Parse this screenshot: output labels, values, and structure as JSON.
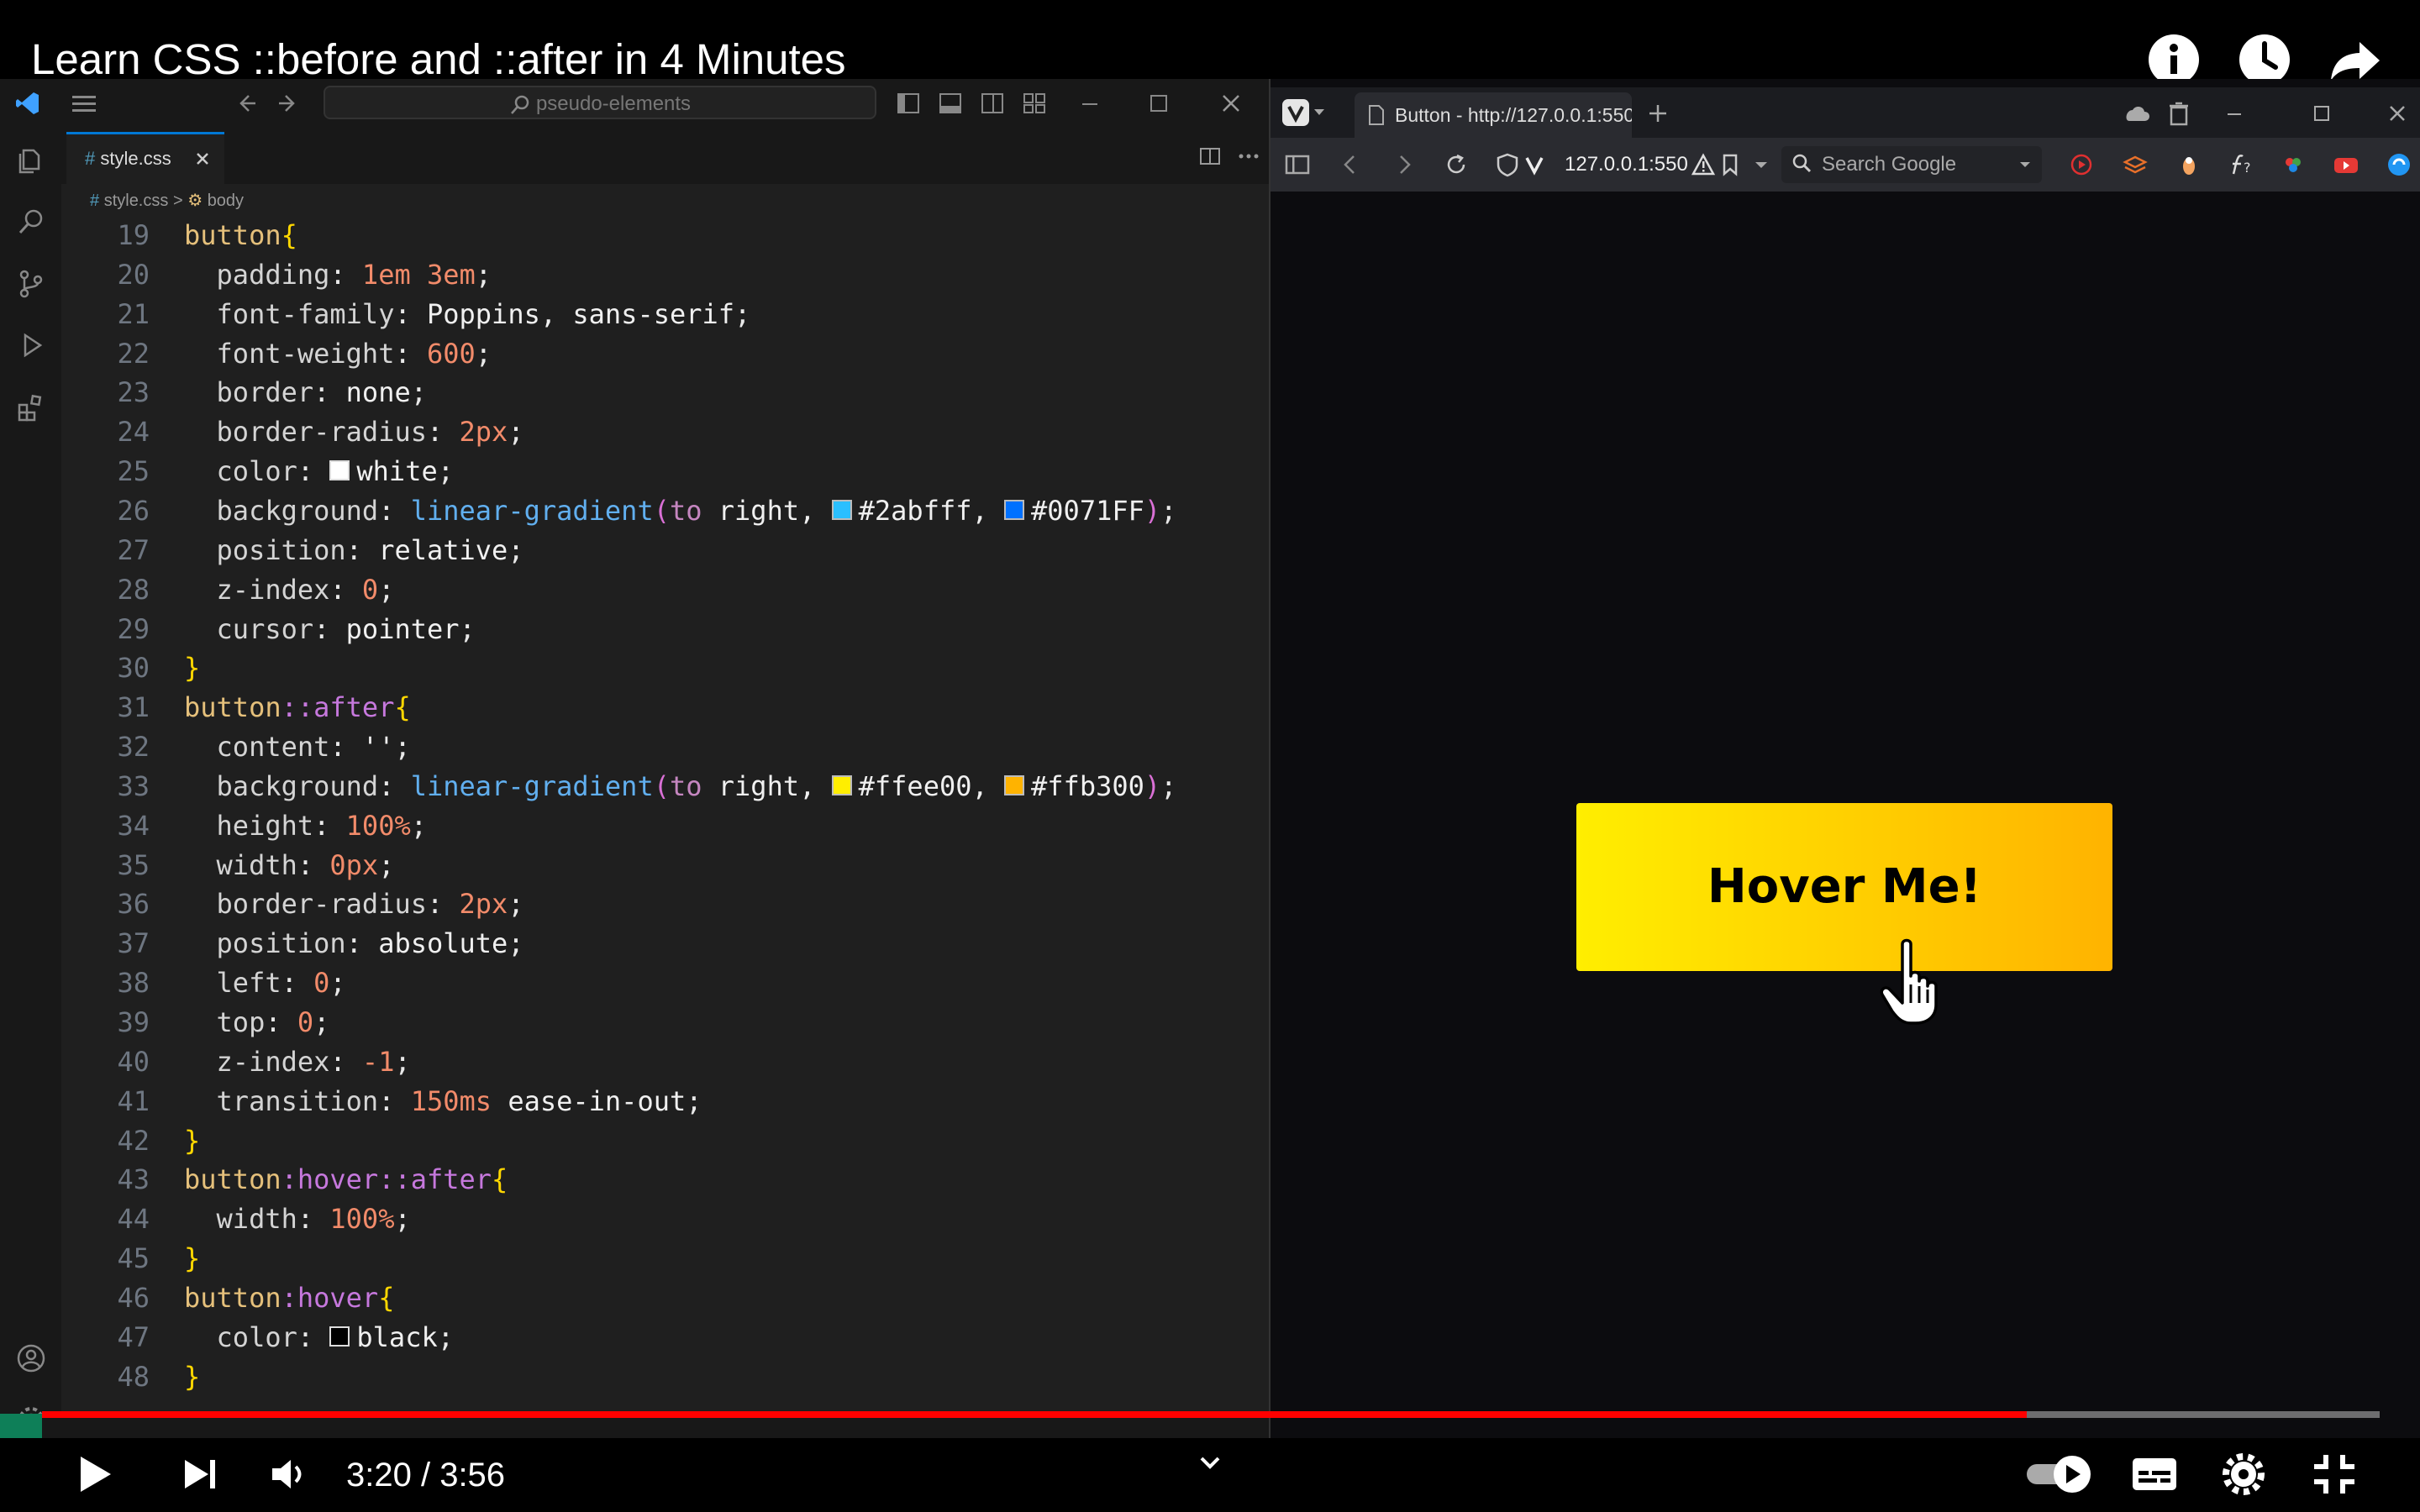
{
  "video": {
    "title": "Learn CSS ::before and ::after in 4 Minutes",
    "time": "3:20 / 3:56",
    "progress": 0.849
  },
  "vscode": {
    "search_text": "pseudo-elements",
    "tab_label": "style.css",
    "breadcrumb_file": "style.css",
    "breadcrumb_sep": ">",
    "breadcrumb_symbol": "body",
    "lines": [
      {
        "n": "19",
        "code": "button{"
      },
      {
        "n": "20",
        "code": "  padding: 1em 3em;"
      },
      {
        "n": "21",
        "code": "  font-family: Poppins, sans-serif;"
      },
      {
        "n": "22",
        "code": "  font-weight: 600;"
      },
      {
        "n": "23",
        "code": "  border: none;"
      },
      {
        "n": "24",
        "code": "  border-radius: 2px;"
      },
      {
        "n": "25",
        "code": "  color: white;"
      },
      {
        "n": "26",
        "code": "  background: linear-gradient(to right, #2abfff, #0071FF);"
      },
      {
        "n": "27",
        "code": "  position: relative;"
      },
      {
        "n": "28",
        "code": "  z-index: 0;"
      },
      {
        "n": "29",
        "code": "  cursor: pointer;"
      },
      {
        "n": "30",
        "code": "}"
      },
      {
        "n": "31",
        "code": "button::after{"
      },
      {
        "n": "32",
        "code": "  content: '';"
      },
      {
        "n": "33",
        "code": "  background: linear-gradient(to right, #ffee00, #ffb300);"
      },
      {
        "n": "34",
        "code": "  height: 100%;"
      },
      {
        "n": "35",
        "code": "  width: 0px;"
      },
      {
        "n": "36",
        "code": "  border-radius: 2px;"
      },
      {
        "n": "37",
        "code": "  position: absolute;"
      },
      {
        "n": "38",
        "code": "  left: 0;"
      },
      {
        "n": "39",
        "code": "  top: 0;"
      },
      {
        "n": "40",
        "code": "  z-index: -1;"
      },
      {
        "n": "41",
        "code": "  transition: 150ms ease-in-out;"
      },
      {
        "n": "42",
        "code": "}"
      },
      {
        "n": "43",
        "code": "button:hover::after{"
      },
      {
        "n": "44",
        "code": "  width: 100%;"
      },
      {
        "n": "45",
        "code": "}"
      },
      {
        "n": "46",
        "code": "button:hover{"
      },
      {
        "n": "47",
        "code": "  color: black;"
      },
      {
        "n": "48",
        "code": "}"
      }
    ]
  },
  "browser": {
    "tab_title": "Button - http://127.0.0.1:550",
    "url": "127.0.0.1:550",
    "search_placeholder": "Search Google",
    "button_label": "Hover Me!"
  },
  "colors": {
    "progress": "#ff0000",
    "button_start": "#ffee00",
    "button_end": "#ffb300",
    "swatch_white": "#ffffff",
    "swatch_blue_light": "#2abfff",
    "swatch_blue": "#0071FF",
    "swatch_yellow": "#ffee00",
    "swatch_orange": "#ffb300",
    "swatch_black": "#000000"
  }
}
